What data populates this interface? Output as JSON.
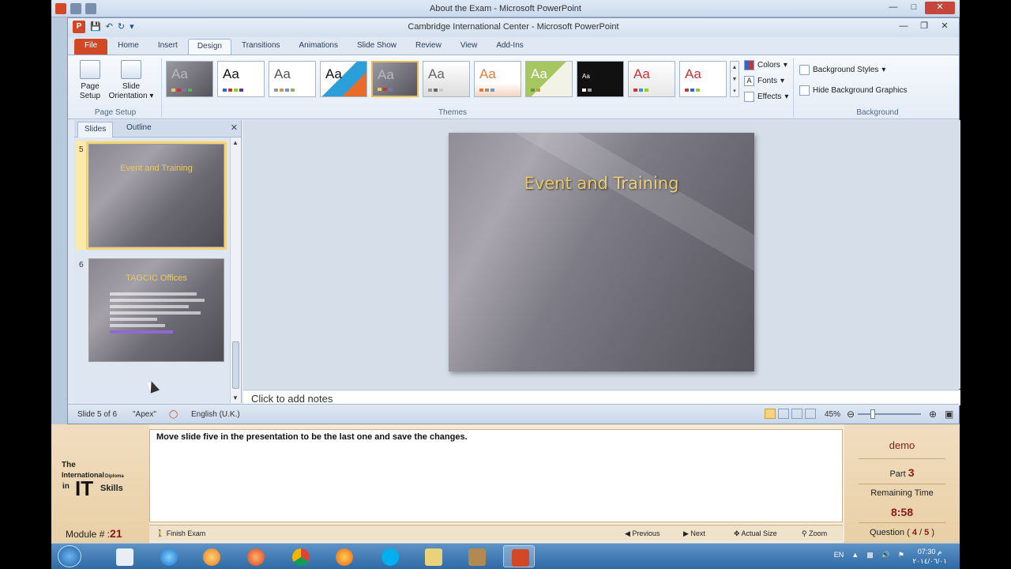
{
  "outer_window": {
    "title": "About the Exam - Microsoft PowerPoint"
  },
  "ppt_window": {
    "title": "Cambridge International Center - Microsoft PowerPoint"
  },
  "ribbon_tabs": [
    "File",
    "Home",
    "Insert",
    "Design",
    "Transitions",
    "Animations",
    "Slide Show",
    "Review",
    "View",
    "Add-Ins"
  ],
  "active_tab": "Design",
  "ribbon": {
    "page_setup_label": "Page\nSetup",
    "page_setup": "Page",
    "page_setup2": "Setup",
    "slide_orientation": "Slide",
    "slide_orientation2": "Orientation",
    "group_page_setup": "Page Setup",
    "group_themes": "Themes",
    "colors": "Colors",
    "fonts": "Fonts",
    "effects": "Effects",
    "background_styles": "Background Styles",
    "hide_bg_graphics": "Hide Background Graphics",
    "group_background": "Background",
    "theme_sample": "Aa"
  },
  "slides_pane": {
    "tab_slides": "Slides",
    "tab_outline": "Outline",
    "slides": [
      {
        "number": "5",
        "title": "Event and Training"
      },
      {
        "number": "6",
        "title": "TAGCIC Offices"
      }
    ]
  },
  "current_slide": {
    "title": "Event and Training"
  },
  "notes_placeholder": "Click to add notes",
  "status_bar": {
    "slide_info": "Slide 5 of 6",
    "theme": "\"Apex\"",
    "language": "English (U.K.)",
    "zoom": "45%"
  },
  "exam": {
    "logo_the": "The",
    "logo_international": "International",
    "logo_diploma": "Diploma",
    "logo_in": "in",
    "logo_it": "IT",
    "logo_skills": "Skills",
    "module_label": "Module # :",
    "module_number": "21",
    "question_text": "Move slide five in the presentation to be the last one and save the changes.",
    "finish_exam": "Finish Exam",
    "previous": "Previous",
    "next": "Next",
    "actual_size": "Actual Size",
    "zoom": "Zoom",
    "user": "demo",
    "part_label": "Part",
    "part_number": "3",
    "remaining_label": "Remaining Time",
    "remaining_time": "8:58",
    "question_label": "Question (",
    "question_current": "4",
    "question_sep": "/",
    "question_total": "5",
    "question_close": ")"
  },
  "taskbar": {
    "language": "EN",
    "time": "07:30 م",
    "date": "٢٠١٤/٠٦/٠١"
  }
}
